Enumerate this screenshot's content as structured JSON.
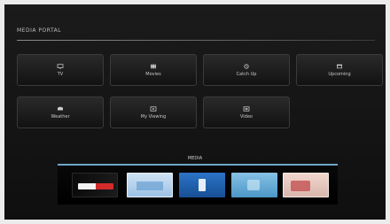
{
  "section": {
    "title": "MEDIA PORTAL"
  },
  "tiles": [
    {
      "label": "TV",
      "icon": "tv-icon"
    },
    {
      "label": "Movies",
      "icon": "film-icon"
    },
    {
      "label": "Catch Up",
      "icon": "clock-icon"
    },
    {
      "label": "Upcoming",
      "icon": "calendar-icon"
    },
    {
      "label": "Weather",
      "icon": "weather-icon"
    },
    {
      "label": "My Viewing",
      "icon": "viewing-icon"
    },
    {
      "label": "Video",
      "icon": "video-icon"
    }
  ],
  "media": {
    "title": "MEDIA",
    "accent_color": "#6fa6c9",
    "thumbnails": [
      {
        "name": "thumb-brand-logo"
      },
      {
        "name": "thumb-light-blue"
      },
      {
        "name": "thumb-blue-icon"
      },
      {
        "name": "thumb-sky-blue"
      },
      {
        "name": "thumb-pink-red"
      }
    ]
  }
}
